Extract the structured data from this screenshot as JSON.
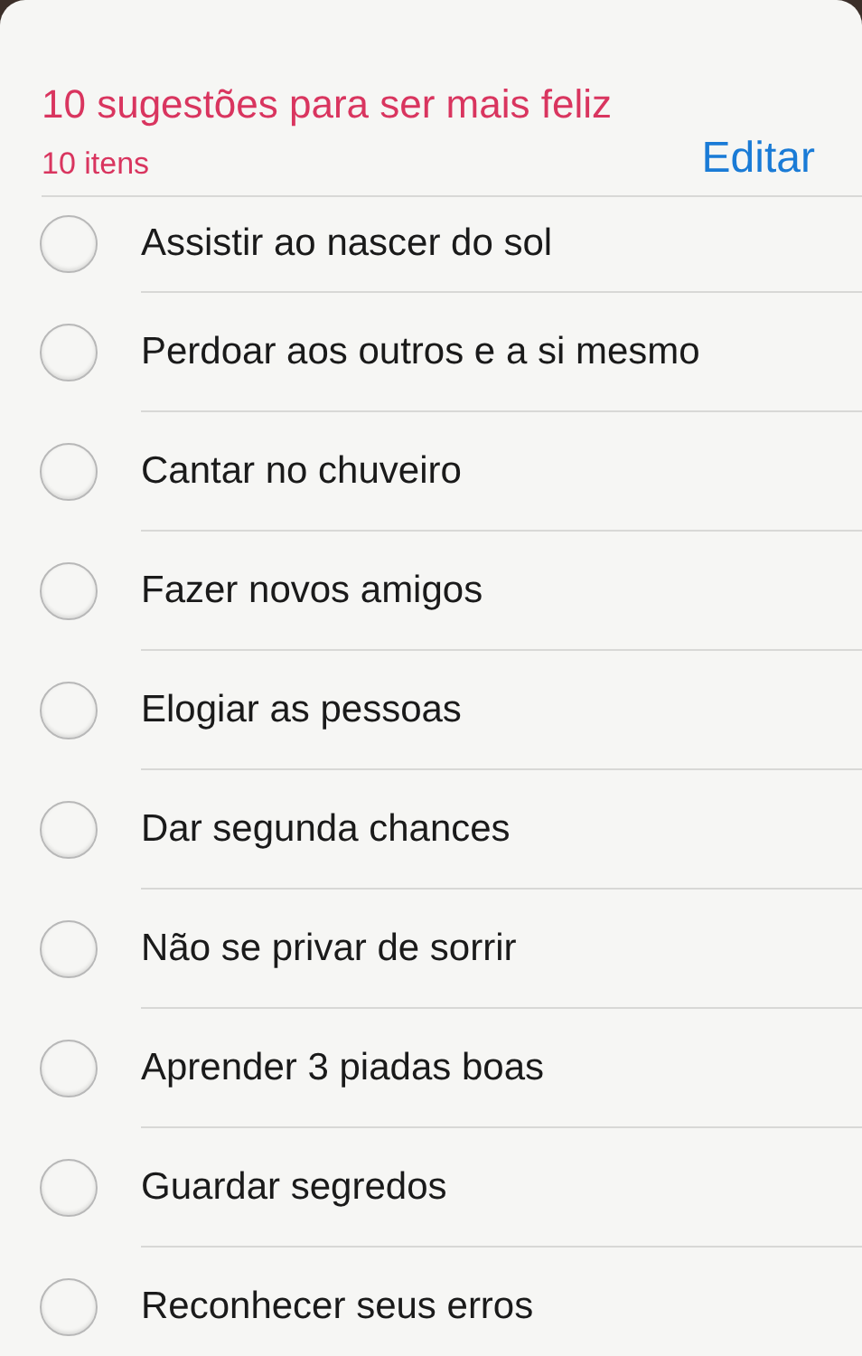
{
  "list": {
    "title": "10 sugestões para ser mais feliz",
    "count": "10 itens",
    "edit_button": "Editar"
  },
  "items": [
    {
      "text": "Assistir ao nascer do sol",
      "checked": false
    },
    {
      "text": "Perdoar aos outros e a si mesmo",
      "checked": false
    },
    {
      "text": "Cantar no chuveiro",
      "checked": false
    },
    {
      "text": "Fazer novos amigos",
      "checked": false
    },
    {
      "text": "Elogiar as pessoas",
      "checked": false
    },
    {
      "text": "Dar segunda chances",
      "checked": false
    },
    {
      "text": "Não se privar de sorrir",
      "checked": false
    },
    {
      "text": "Aprender 3 piadas boas",
      "checked": false
    },
    {
      "text": "Guardar segredos",
      "checked": false
    },
    {
      "text": "Reconhecer seus erros",
      "checked": false
    }
  ]
}
